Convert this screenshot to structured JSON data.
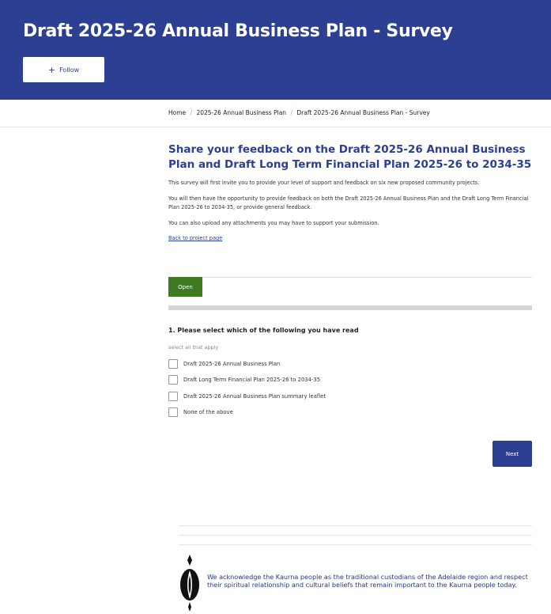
{
  "header": {
    "title": "Draft 2025-26 Annual Business Plan - Survey",
    "follow_icon": "plus-icon",
    "follow_label": "Follow"
  },
  "breadcrumb": {
    "items": [
      "Home",
      "2025-26 Annual Business Plan",
      "Draft 2025-26 Annual Business Plan - Survey"
    ],
    "separator": "/"
  },
  "intro": {
    "heading": "Share your feedback on the Draft 2025-26 Annual Business Plan and Draft Long Term Financial Plan 2025-26 to 2034-35",
    "paragraphs": [
      "This survey will first invite you to provide your level of support and feedback on six new proposed community projects.",
      "You will then have the opportunity to provide feedback on both the Draft 2025-26 Annual Business Plan and the Draft Long Term Financial Plan 2025-26 to 2034-35, or provide general feedback.",
      "You can also upload any attachments you may have to support your submission."
    ],
    "back_link": "Back to project page"
  },
  "status": {
    "label": "Open",
    "color": "#3e7a22"
  },
  "question": {
    "text": "1. Please select which of the following you have read",
    "hint": "select all that apply",
    "options": [
      {
        "label": "Draft 2025-26 Annual Business Plan",
        "checked": false
      },
      {
        "label": "Draft Long Term Financial Plan 2025-26 to 2034-35",
        "checked": false
      },
      {
        "label": "Draft 2025-26 Annual Business Plan summary leaflet",
        "checked": false
      },
      {
        "label": "None of the above",
        "checked": false
      }
    ]
  },
  "actions": {
    "next_label": "Next"
  },
  "footer": {
    "acknowledgement": "We acknowledge the Kaurna people as the traditional custodians of the Adelaide region and respect their spiritual relationship and cultural beliefs that remain important to the Kaurna people today.",
    "logo_icon": "kaurna-shield-icon"
  },
  "colors": {
    "brand": "#2c3f93",
    "breadcrumb_separator": "#e0a020",
    "status_open": "#3e7a22"
  }
}
